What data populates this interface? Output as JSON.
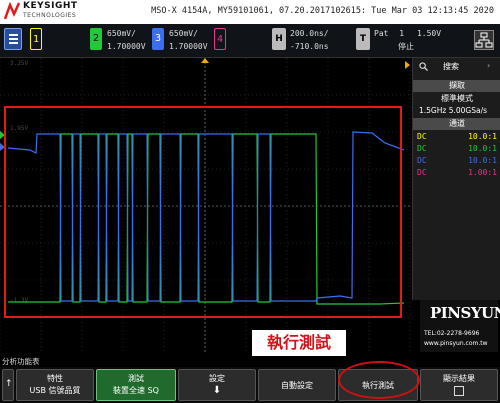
{
  "header": {
    "brand": "KEYSIGHT",
    "brand_sub": "TECHNOLOGIES",
    "instrument_info": "MSO-X 4154A, MY59101061, 07.20.2017102615: Tue Mar 03 12:13:45 2020"
  },
  "channels": [
    {
      "num": "1",
      "color": "#ffff00",
      "active": false
    },
    {
      "num": "2",
      "color": "#22c83a",
      "active": true,
      "scale": "650mV/",
      "offset": "1.70000V"
    },
    {
      "num": "3",
      "color": "#3d6ef0",
      "active": true,
      "scale": "650mV/",
      "offset": "1.70000V"
    },
    {
      "num": "4",
      "color": "#e8368f",
      "active": false
    }
  ],
  "horizontal": {
    "icon": "H",
    "scale": "200.0ns/",
    "delay": "-710.0ns"
  },
  "trigger": {
    "icon": "T",
    "mode": "Pat",
    "source": "1",
    "level": "1.50V",
    "state": "停止"
  },
  "side_panel": {
    "tab": "搜索",
    "acq_header": "擷取",
    "acq_mode": "標準模式",
    "sample_rate": "1.5GHz  5.00GSa/s",
    "chan_header": "通道",
    "rows": [
      {
        "coupling": "DC",
        "probe": "10.0:1",
        "color": "#ffff00"
      },
      {
        "coupling": "DC",
        "probe": "10.0:1",
        "color": "#22c83a"
      },
      {
        "coupling": "DC",
        "probe": "10.0:1",
        "color": "#3d6ef0"
      },
      {
        "coupling": "DC",
        "probe": "1.00:1",
        "color": "#e8368f"
      }
    ]
  },
  "watermark": {
    "name": "PINSYUN",
    "tel": "TEL:02-2278-9696",
    "web": "www.pinsyun.com.tw"
  },
  "caption": "執行測試",
  "softkeys": {
    "menu_title": "分析功能表",
    "keys": [
      {
        "line1": "特性",
        "line2": "USB 信號品質"
      },
      {
        "line1": "測試",
        "line2": "裝置全速 SQ"
      },
      {
        "line1": "設定",
        "line2": ""
      },
      {
        "line1": "自動設定",
        "line2": ""
      },
      {
        "line1": "執行測試",
        "line2": ""
      },
      {
        "line1": "顯示結果",
        "line2": ""
      }
    ]
  },
  "colors": {
    "green": "#22c83a",
    "blue": "#3d6ef0",
    "highlight": "#e21a1a"
  }
}
